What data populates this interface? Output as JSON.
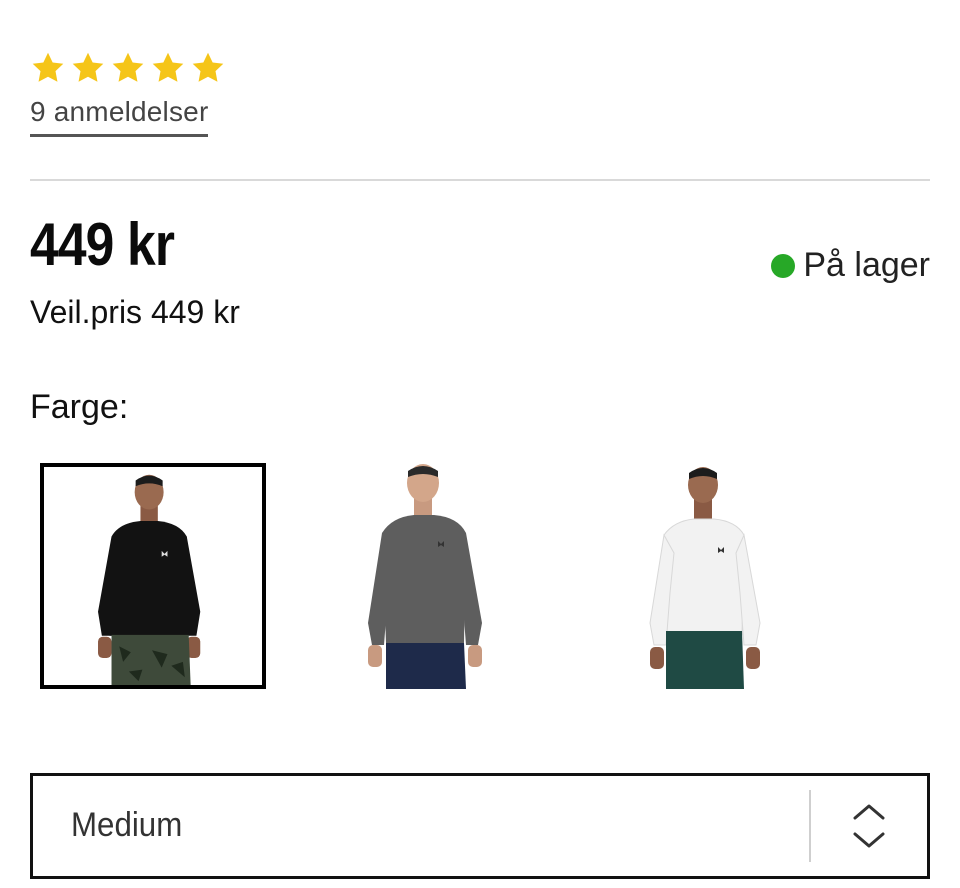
{
  "rating": {
    "stars": 5,
    "reviews_label": "9 anmeldelser"
  },
  "price": {
    "current": "449 kr",
    "recommended": "Veil.pris 449 kr"
  },
  "stock": {
    "label": "På lager",
    "color": "#27a827"
  },
  "color_picker": {
    "label": "Farge:",
    "options": [
      {
        "shirt": "#121212",
        "selected": true
      },
      {
        "shirt": "#5e5e5e",
        "selected": false
      },
      {
        "shirt": "#f2f2f2",
        "selected": false
      }
    ]
  },
  "size_select": {
    "value": "Medium"
  },
  "colors": {
    "star": "#f5c518",
    "border": "#111111"
  }
}
